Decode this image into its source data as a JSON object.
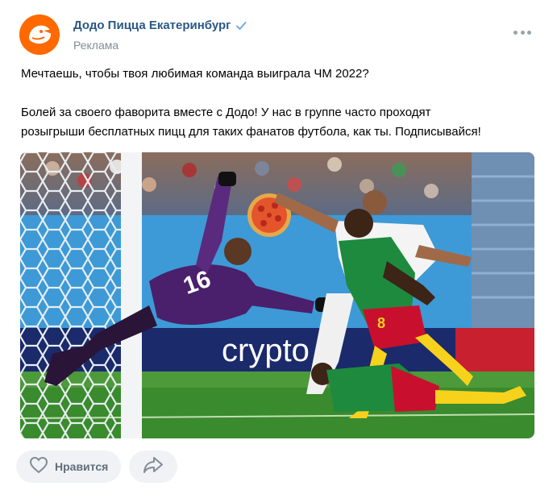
{
  "post": {
    "author": "Додо Пицца Екатеринбург",
    "subtitle": "Реклама",
    "text_line1": "Мечтаешь, чтобы твоя любимая команда выиграла ЧМ 2022?",
    "text_line2": "Болей за своего фаворита вместе с Додо! У нас в группе часто проходят",
    "text_line3": "розыгрыши бесплатных пицц для таких фанатов футбола, как ты. Подписывайся!",
    "photo_board_text": "crypto",
    "photo_jersey_gk": "16",
    "photo_jersey_player": "8"
  },
  "actions": {
    "like_label": "Нравится"
  },
  "icons": {
    "avatar": "dodo-logo-icon",
    "verified": "verified-check-icon",
    "more": "more-dots-icon",
    "like": "heart-icon",
    "share": "share-arrow-icon"
  },
  "colors": {
    "author_link": "#2a5885",
    "muted": "#818c99",
    "button_bg": "#f0f2f5",
    "brand_orange": "#ff6900"
  }
}
